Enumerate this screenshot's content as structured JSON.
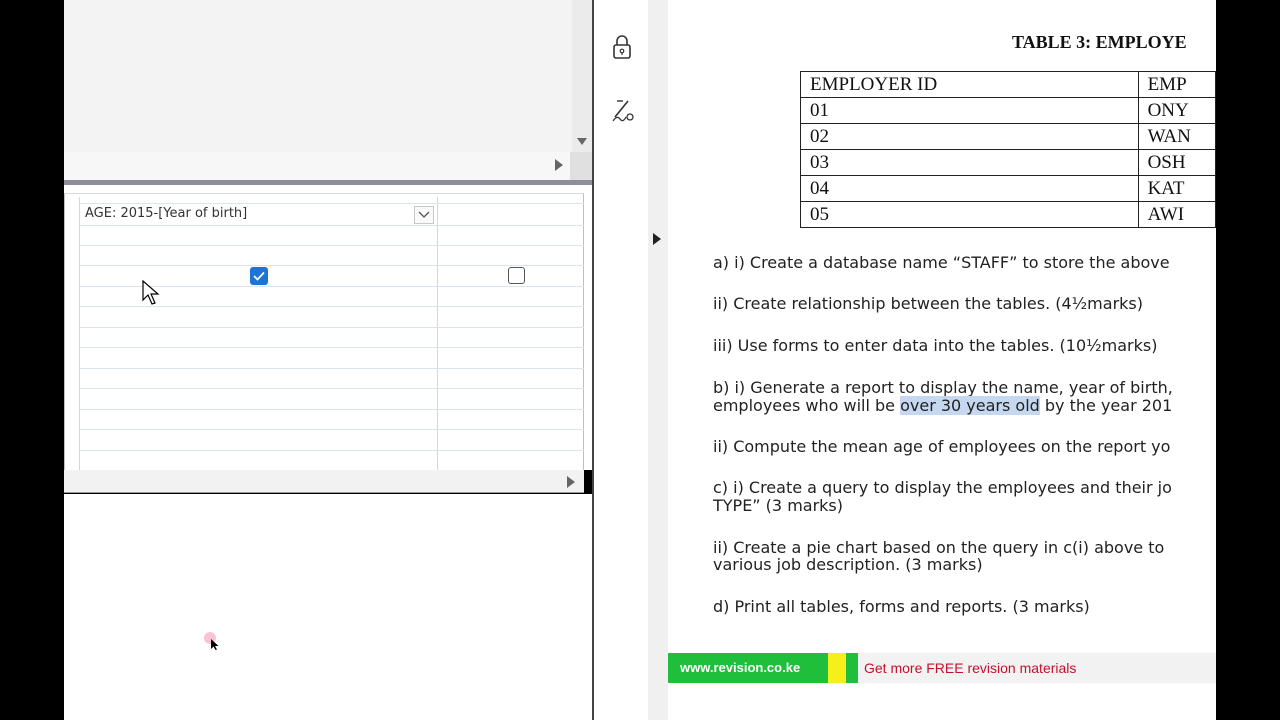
{
  "query_design": {
    "field_expression": "AGE: 2015-[Year of birth]",
    "show_checked": true,
    "second_checked": false
  },
  "pdf": {
    "table_title": "TABLE 3: EMPLOYE",
    "table": {
      "headers": [
        "EMPLOYER ID",
        "EMP"
      ],
      "rows": [
        [
          "01",
          "ONY"
        ],
        [
          "02",
          "WAN"
        ],
        [
          "03",
          "OSH"
        ],
        [
          "04",
          "KAT"
        ],
        [
          "05",
          "AWI"
        ]
      ]
    },
    "questions": {
      "a1": "a) i) Create a database name “STAFF” to store the above",
      "a2": "ii) Create relationship between the tables. (4½marks)",
      "a3": "iii) Use forms to enter data into the tables. (10½marks)",
      "b1_line1": "b) i) Generate a report to display the name, year of birth,",
      "b1_line2_pre": "employees who will be ",
      "b1_line2_highlight": "over 30 years old",
      "b1_line2_post": " by the year 201",
      "b2": "ii) Compute the mean age of employees on the report yo",
      "c1_line1": "c) i) Create a query to display the employees and their jo",
      "c1_line2": "TYPE” (3 marks)",
      "c2_line1": "ii) Create a pie chart based on the query in c(i) above to",
      "c2_line2": "various job description. (3 marks)",
      "d": "d) Print all tables, forms and reports. (3 marks)"
    },
    "footer": {
      "site": "www.revision.co.ke",
      "promo": "Get more FREE revision materials"
    }
  },
  "icons": [
    "lock-icon",
    "sign-icon",
    "expand-arrow-icon",
    "scroll-down-arrow-icon",
    "scroll-right-arrow-icon",
    "dropdown-chevron-icon",
    "checkmark-icon",
    "mouse-cursor-icon"
  ],
  "colors": {
    "checkbox_blue": "#1e73d6",
    "highlight": "#c5d8ef",
    "footer_green": "#1fbf3c",
    "footer_yellow": "#f7ef1a",
    "footer_red_text": "#c8102e"
  }
}
